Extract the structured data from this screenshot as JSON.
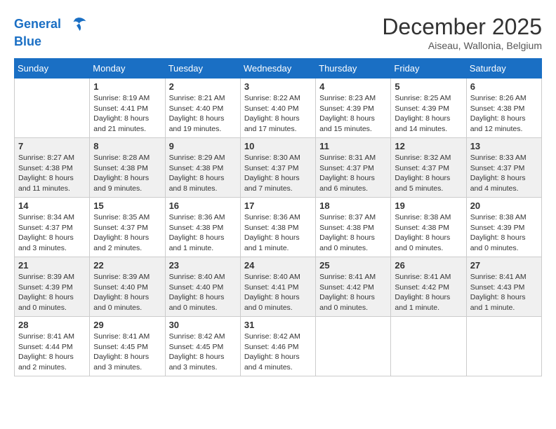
{
  "logo": {
    "line1": "General",
    "line2": "Blue"
  },
  "title": "December 2025",
  "location": "Aiseau, Wallonia, Belgium",
  "weekdays": [
    "Sunday",
    "Monday",
    "Tuesday",
    "Wednesday",
    "Thursday",
    "Friday",
    "Saturday"
  ],
  "weeks": [
    [
      {
        "day": "",
        "info": ""
      },
      {
        "day": "1",
        "info": "Sunrise: 8:19 AM\nSunset: 4:41 PM\nDaylight: 8 hours\nand 21 minutes."
      },
      {
        "day": "2",
        "info": "Sunrise: 8:21 AM\nSunset: 4:40 PM\nDaylight: 8 hours\nand 19 minutes."
      },
      {
        "day": "3",
        "info": "Sunrise: 8:22 AM\nSunset: 4:40 PM\nDaylight: 8 hours\nand 17 minutes."
      },
      {
        "day": "4",
        "info": "Sunrise: 8:23 AM\nSunset: 4:39 PM\nDaylight: 8 hours\nand 15 minutes."
      },
      {
        "day": "5",
        "info": "Sunrise: 8:25 AM\nSunset: 4:39 PM\nDaylight: 8 hours\nand 14 minutes."
      },
      {
        "day": "6",
        "info": "Sunrise: 8:26 AM\nSunset: 4:38 PM\nDaylight: 8 hours\nand 12 minutes."
      }
    ],
    [
      {
        "day": "7",
        "info": "Sunrise: 8:27 AM\nSunset: 4:38 PM\nDaylight: 8 hours\nand 11 minutes."
      },
      {
        "day": "8",
        "info": "Sunrise: 8:28 AM\nSunset: 4:38 PM\nDaylight: 8 hours\nand 9 minutes."
      },
      {
        "day": "9",
        "info": "Sunrise: 8:29 AM\nSunset: 4:38 PM\nDaylight: 8 hours\nand 8 minutes."
      },
      {
        "day": "10",
        "info": "Sunrise: 8:30 AM\nSunset: 4:37 PM\nDaylight: 8 hours\nand 7 minutes."
      },
      {
        "day": "11",
        "info": "Sunrise: 8:31 AM\nSunset: 4:37 PM\nDaylight: 8 hours\nand 6 minutes."
      },
      {
        "day": "12",
        "info": "Sunrise: 8:32 AM\nSunset: 4:37 PM\nDaylight: 8 hours\nand 5 minutes."
      },
      {
        "day": "13",
        "info": "Sunrise: 8:33 AM\nSunset: 4:37 PM\nDaylight: 8 hours\nand 4 minutes."
      }
    ],
    [
      {
        "day": "14",
        "info": "Sunrise: 8:34 AM\nSunset: 4:37 PM\nDaylight: 8 hours\nand 3 minutes."
      },
      {
        "day": "15",
        "info": "Sunrise: 8:35 AM\nSunset: 4:37 PM\nDaylight: 8 hours\nand 2 minutes."
      },
      {
        "day": "16",
        "info": "Sunrise: 8:36 AM\nSunset: 4:38 PM\nDaylight: 8 hours\nand 1 minute."
      },
      {
        "day": "17",
        "info": "Sunrise: 8:36 AM\nSunset: 4:38 PM\nDaylight: 8 hours\nand 1 minute."
      },
      {
        "day": "18",
        "info": "Sunrise: 8:37 AM\nSunset: 4:38 PM\nDaylight: 8 hours\nand 0 minutes."
      },
      {
        "day": "19",
        "info": "Sunrise: 8:38 AM\nSunset: 4:38 PM\nDaylight: 8 hours\nand 0 minutes."
      },
      {
        "day": "20",
        "info": "Sunrise: 8:38 AM\nSunset: 4:39 PM\nDaylight: 8 hours\nand 0 minutes."
      }
    ],
    [
      {
        "day": "21",
        "info": "Sunrise: 8:39 AM\nSunset: 4:39 PM\nDaylight: 8 hours\nand 0 minutes."
      },
      {
        "day": "22",
        "info": "Sunrise: 8:39 AM\nSunset: 4:40 PM\nDaylight: 8 hours\nand 0 minutes."
      },
      {
        "day": "23",
        "info": "Sunrise: 8:40 AM\nSunset: 4:40 PM\nDaylight: 8 hours\nand 0 minutes."
      },
      {
        "day": "24",
        "info": "Sunrise: 8:40 AM\nSunset: 4:41 PM\nDaylight: 8 hours\nand 0 minutes."
      },
      {
        "day": "25",
        "info": "Sunrise: 8:41 AM\nSunset: 4:42 PM\nDaylight: 8 hours\nand 0 minutes."
      },
      {
        "day": "26",
        "info": "Sunrise: 8:41 AM\nSunset: 4:42 PM\nDaylight: 8 hours\nand 1 minute."
      },
      {
        "day": "27",
        "info": "Sunrise: 8:41 AM\nSunset: 4:43 PM\nDaylight: 8 hours\nand 1 minute."
      }
    ],
    [
      {
        "day": "28",
        "info": "Sunrise: 8:41 AM\nSunset: 4:44 PM\nDaylight: 8 hours\nand 2 minutes."
      },
      {
        "day": "29",
        "info": "Sunrise: 8:41 AM\nSunset: 4:45 PM\nDaylight: 8 hours\nand 3 minutes."
      },
      {
        "day": "30",
        "info": "Sunrise: 8:42 AM\nSunset: 4:45 PM\nDaylight: 8 hours\nand 3 minutes."
      },
      {
        "day": "31",
        "info": "Sunrise: 8:42 AM\nSunset: 4:46 PM\nDaylight: 8 hours\nand 4 minutes."
      },
      {
        "day": "",
        "info": ""
      },
      {
        "day": "",
        "info": ""
      },
      {
        "day": "",
        "info": ""
      }
    ]
  ]
}
